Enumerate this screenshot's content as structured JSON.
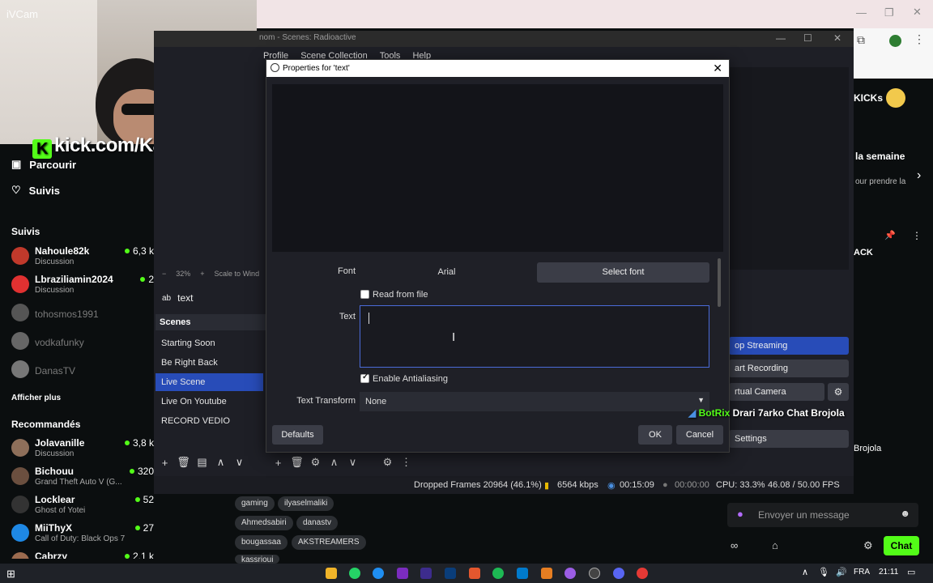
{
  "webcam": {
    "app_label": "iVCam",
    "overlay_text": "kick.com/Kassrioui"
  },
  "sidebar": {
    "nav": [
      {
        "label": "Parcourir",
        "icon": "browse-icon"
      },
      {
        "label": "Suivis",
        "icon": "heart-icon"
      }
    ],
    "following_title": "Suivis",
    "following": [
      {
        "name": "Nahoule82k",
        "category": "Discussion",
        "viewers": "6,3 k",
        "live": true
      },
      {
        "name": "Lbraziliamin2024",
        "category": "Discussion",
        "viewers": "2",
        "live": true
      },
      {
        "name": "tohosmos1991",
        "live": false
      },
      {
        "name": "vodkafunky",
        "live": false
      },
      {
        "name": "DanasTV",
        "live": false
      }
    ],
    "show_more": "Afficher plus",
    "recommended_title": "Recommandés",
    "recommended": [
      {
        "name": "Jolavanille",
        "category": "Discussion",
        "viewers": "3,8 k"
      },
      {
        "name": "Bichouu",
        "category": "Grand Theft Auto V (G...",
        "viewers": "320"
      },
      {
        "name": "Locklear",
        "category": "Ghost of Yotei",
        "viewers": "52"
      },
      {
        "name": "MiiThyX",
        "category": "Call of Duty: Black Ops 7",
        "viewers": "27"
      },
      {
        "name": "Cabrzy",
        "category": "",
        "viewers": "2,1 k"
      }
    ]
  },
  "kick_right": {
    "kicks_label": "KICKs",
    "week_label": "la semaine",
    "week_sub": "our prendre la",
    "pinned_label": "ACK",
    "chat_partial": "Brojola"
  },
  "obs": {
    "title": "nom - Scenes: Radioactive",
    "menu": [
      "Profile",
      "Scene Collection",
      "Tools",
      "Help"
    ],
    "zoom": "32%",
    "scale_label": "Scale to Wind",
    "source_name": "text",
    "scenes_title": "Scenes",
    "scenes": [
      "Starting Soon",
      "Be Right Back",
      "Live Scene",
      "Live On Youtube",
      "RECORD VEDIO"
    ],
    "selected_scene": "Live Scene",
    "controls": [
      "op Streaming",
      "art Recording",
      "rtual Camera",
      "Settings"
    ],
    "status": {
      "dropped": "Dropped Frames 20964 (46.1%)",
      "bitrate": "6564 kbps",
      "live_time": "00:15:09",
      "rec_time": "00:00:00",
      "cpu": "CPU: 33.3%",
      "fps": "46.08 / 50.00 FPS"
    }
  },
  "dialog": {
    "title": "Properties for 'text'",
    "font_label": "Font",
    "font_value": "Arial",
    "select_font": "Select font",
    "read_from_file": "Read from file",
    "read_from_file_checked": false,
    "text_label": "Text",
    "text_value": "",
    "antialias_label": "Enable Antialiasing",
    "antialias_checked": true,
    "transform_label": "Text Transform",
    "transform_value": "None",
    "defaults": "Defaults",
    "ok": "OK",
    "cancel": "Cancel"
  },
  "chat": {
    "bot_name": "BotRix",
    "bot_message": "Drari 7arko Chat Brojola",
    "input_placeholder": "Envoyer un message",
    "chat_button": "Chat"
  },
  "tags": [
    "gaming",
    "ilyaselmaliki",
    "Ahmedsabiri",
    "danastv",
    "bougassaa",
    "AKSTREAMERS",
    "kassrioui"
  ],
  "taskbar": {
    "lang": "FRA",
    "time": "21:11"
  },
  "colors": {
    "kick_green": "#53fc18",
    "obs_selected": "#284cb8",
    "dialog_bg": "#1f2027"
  }
}
